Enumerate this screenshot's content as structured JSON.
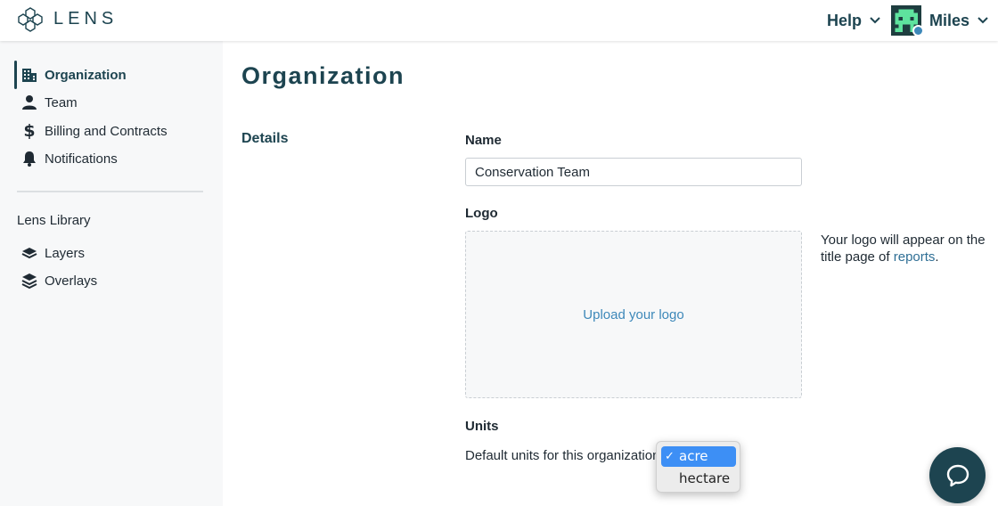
{
  "app": {
    "name": "LENS",
    "logo_icon": "hexagon-cluster-icon"
  },
  "header": {
    "help_label": "Help",
    "user_name": "Miles",
    "avatar_icon": "pixel-avatar-icon",
    "status_color": "#3d88b9"
  },
  "sidebar": {
    "items": [
      {
        "label": "Organization",
        "icon": "building-icon",
        "active": true
      },
      {
        "label": "Team",
        "icon": "person-icon"
      },
      {
        "label": "Billing and Contracts",
        "icon": "dollar-icon"
      },
      {
        "label": "Notifications",
        "icon": "bell-icon"
      }
    ],
    "library_title": "Lens Library",
    "library_items": [
      {
        "label": "Layers",
        "icon": "layer-icon"
      },
      {
        "label": "Overlays",
        "icon": "layers-stack-icon"
      }
    ]
  },
  "main": {
    "title": "Organization",
    "section": "Details",
    "name_label": "Name",
    "name_value": "Conservation Team",
    "logo_label": "Logo",
    "upload_text": "Upload your logo",
    "logo_help_prefix": "Your logo will appear on the title page of",
    "logo_help_link": "reports",
    "logo_help_suffix": ".",
    "units_label": "Units",
    "units_description": "Default units for this organization",
    "units_options": [
      "acre",
      "hectare"
    ],
    "units_selected": "acre"
  },
  "chat": {
    "icon": "chat-bubble-icon"
  },
  "colors": {
    "brand": "#1d4450",
    "link": "#3d88b9",
    "sidebar_bg": "#f7f8f9",
    "select_highlight": "#3d8ff5"
  }
}
